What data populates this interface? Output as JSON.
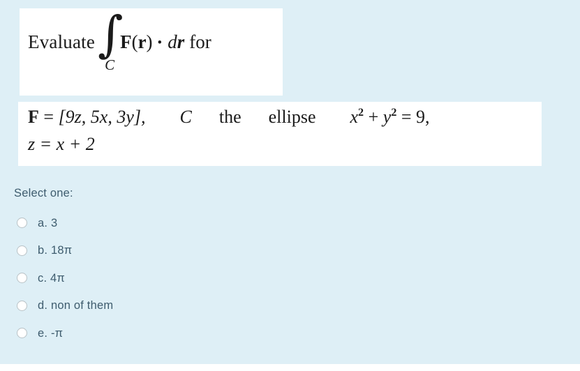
{
  "colors": {
    "page_background": "#deeff6",
    "math_block_background": "#ffffff",
    "option_text": "#3e5c6e",
    "radio_border": "#b9c2c6",
    "math_text": "#1b1b1b"
  },
  "question": {
    "prompt_block": {
      "evaluate_word": "Evaluate",
      "integral_symbol": "∫",
      "integral_subscript": "C",
      "field_symbol": "F",
      "open_paren": "(",
      "position_vector": "r",
      "close_paren": ")",
      "dot_operator": "•",
      "differential_d": "d",
      "differential_r": "r",
      "for_word": "for"
    },
    "definition_block": {
      "line1_field": "F",
      "line1_equals": "=",
      "line1_components": "[9z, 5x, 3y],",
      "line1_curve": "C",
      "line1_the": "the",
      "line1_ellipse": "ellipse",
      "line1_eq_x": "x",
      "line1_eq_x_pow": "2",
      "line1_eq_plus": "+",
      "line1_eq_y": "y",
      "line1_eq_y_pow": "2",
      "line1_eq_equals": "= 9,",
      "line2": "z = x + 2"
    }
  },
  "answers": {
    "select_label": "Select one:",
    "options": [
      {
        "id": "a",
        "label": "a. 3",
        "selected": false
      },
      {
        "id": "b",
        "label": "b. 18π",
        "selected": false
      },
      {
        "id": "c",
        "label": "c. 4π",
        "selected": false
      },
      {
        "id": "d",
        "label": "d. non of them",
        "selected": false
      },
      {
        "id": "e",
        "label": "e. -π",
        "selected": false
      }
    ]
  }
}
